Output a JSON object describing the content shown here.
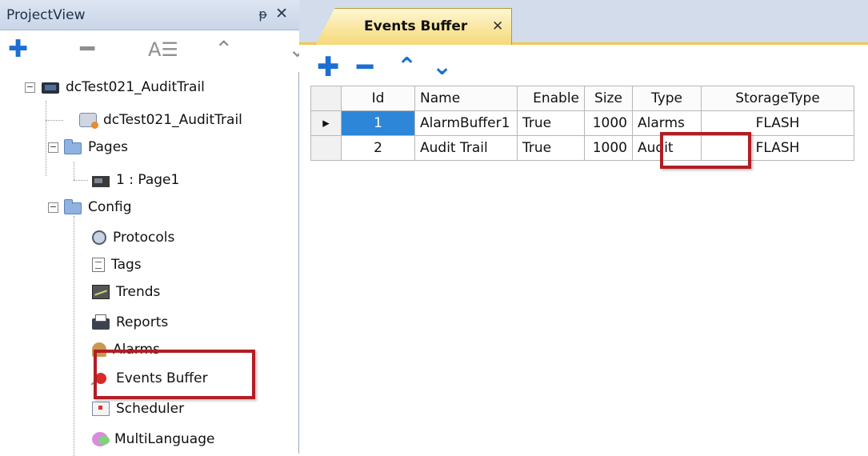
{
  "project_view": {
    "title": "ProjectView",
    "pin_icon": "pin-icon",
    "close_icon": "close-icon",
    "toolbar": {
      "add_icon": "plus-icon",
      "remove_icon": "minus-icon",
      "properties_icon": "properties-icon",
      "up_icon": "chevron-up-icon",
      "down_icon": "chevron-down-icon"
    },
    "tree": {
      "project": "dcTest021_AuditTrail",
      "device": "dcTest021_AuditTrail",
      "pages": "Pages",
      "page1": "1 : Page1",
      "config": "Config",
      "config_items": [
        "Protocols",
        "Tags",
        "Trends",
        "Reports",
        "Alarms",
        "Events Buffer",
        "Scheduler",
        "MultiLanguage"
      ]
    }
  },
  "editor": {
    "tab_label": "Events Buffer",
    "tab_close": "✕",
    "toolbar": {
      "add_icon": "plus-icon",
      "remove_icon": "minus-icon",
      "up_icon": "chevron-up-icon",
      "down_icon": "chevron-down-icon"
    },
    "grid": {
      "columns": [
        "Id",
        "Name",
        "Enable",
        "Size",
        "Type",
        "StorageType"
      ],
      "rows": [
        {
          "id": "1",
          "name": "AlarmBuffer1",
          "enable": "True",
          "size": "1000",
          "type": "Alarms",
          "storage": "FLASH"
        },
        {
          "id": "2",
          "name": "Audit Trail",
          "enable": "True",
          "size": "1000",
          "type": "Audit",
          "storage": "FLASH"
        }
      ]
    }
  },
  "colors": {
    "highlight": "#b01e24",
    "selection": "#2e86d8",
    "tab_active": "#f5d978",
    "accent": "#1c6fd1"
  }
}
